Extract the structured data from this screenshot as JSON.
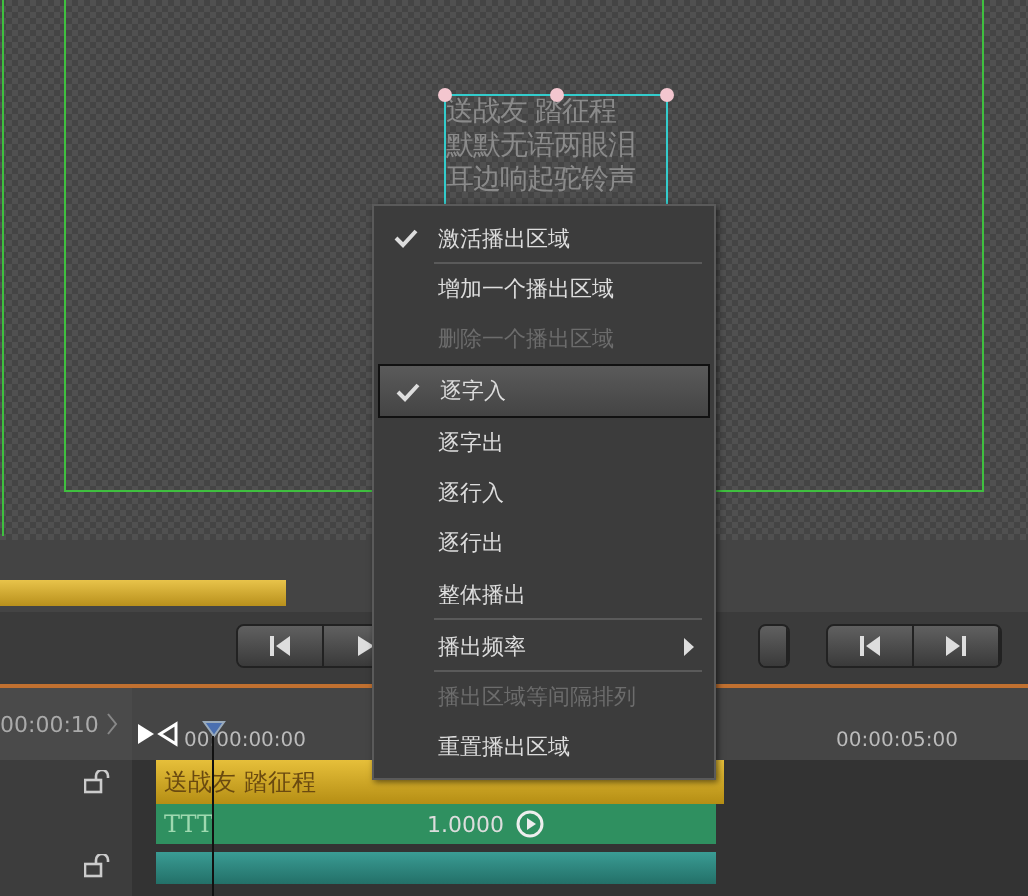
{
  "preview": {
    "text_lines": [
      "送战友 踏征程",
      "默默无语两眼泪",
      "耳边响起驼铃声"
    ]
  },
  "timeline": {
    "timecode": "00:00:10",
    "ruler_marks": [
      "00:00:00:00",
      "00:00:05:00"
    ],
    "tracks": [
      {
        "kind": "title",
        "label": "送战友 踏征程"
      },
      {
        "kind": "effect",
        "label": "TTT",
        "value": "1.0000"
      },
      {
        "kind": "plain"
      }
    ]
  },
  "context_menu": {
    "items": [
      {
        "label": "激活播出区域",
        "checked": true,
        "disabled": false,
        "selected": false,
        "submenu": false,
        "divider_after": true
      },
      {
        "label": "增加一个播出区域",
        "checked": false,
        "disabled": false,
        "selected": false,
        "submenu": false,
        "divider_after": false
      },
      {
        "label": "删除一个播出区域",
        "checked": false,
        "disabled": true,
        "selected": false,
        "submenu": false,
        "divider_after": false
      },
      {
        "label": "逐字入",
        "checked": true,
        "disabled": false,
        "selected": true,
        "submenu": false,
        "divider_after": false
      },
      {
        "label": "逐字出",
        "checked": false,
        "disabled": false,
        "selected": false,
        "submenu": false,
        "divider_after": false
      },
      {
        "label": "逐行入",
        "checked": false,
        "disabled": false,
        "selected": false,
        "submenu": false,
        "divider_after": false
      },
      {
        "label": "逐行出",
        "checked": false,
        "disabled": false,
        "selected": false,
        "submenu": false,
        "divider_after": false
      },
      {
        "label": "整体播出",
        "checked": false,
        "disabled": false,
        "selected": false,
        "submenu": false,
        "divider_after": true
      },
      {
        "label": "播出频率",
        "checked": false,
        "disabled": false,
        "selected": false,
        "submenu": true,
        "divider_after": true
      },
      {
        "label": "播出区域等间隔排列",
        "checked": false,
        "disabled": true,
        "selected": false,
        "submenu": false,
        "divider_after": false
      },
      {
        "label": "重置播出区域",
        "checked": false,
        "disabled": false,
        "selected": false,
        "submenu": false,
        "divider_after": false
      }
    ]
  }
}
